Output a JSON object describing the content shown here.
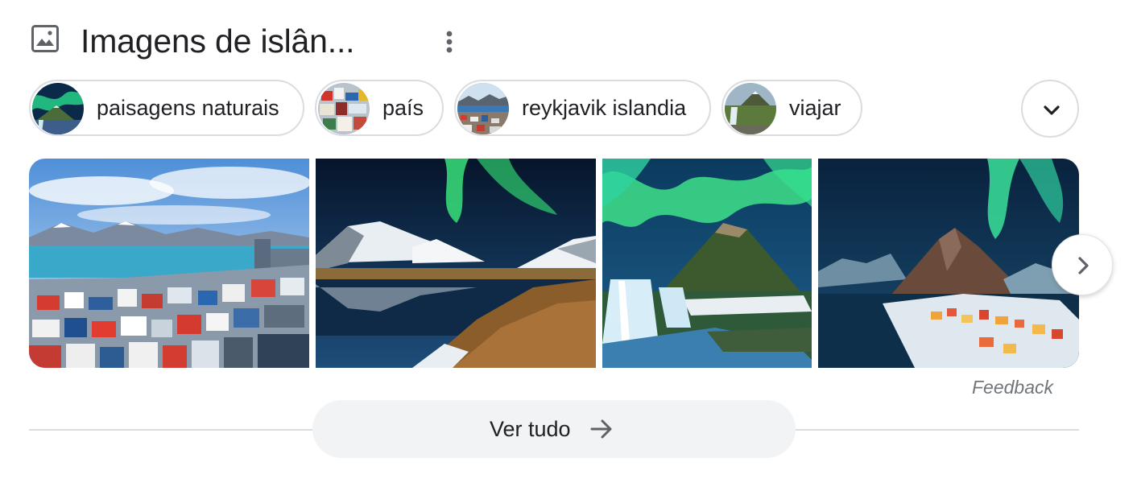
{
  "header": {
    "title": "Imagens de islân...",
    "icon": "image-icon",
    "more_icon": "more-vert-icon"
  },
  "chips": [
    {
      "label": "paisagens naturais",
      "thumb": "aurora-mountain"
    },
    {
      "label": "país",
      "thumb": "colorful-town"
    },
    {
      "label": "reykjavik islandia",
      "thumb": "city-coast"
    },
    {
      "label": "viajar",
      "thumb": "waterfall-mountain"
    }
  ],
  "expand_icon": "chevron-down-icon",
  "images": [
    {
      "subject": "reykjavik-city-view"
    },
    {
      "subject": "aurora-fjord-reflection"
    },
    {
      "subject": "kirkjufell-aurora-waterfall"
    },
    {
      "subject": "aurora-mountain-village"
    }
  ],
  "next_icon": "chevron-right-icon",
  "feedback_label": "Feedback",
  "see_all": {
    "label": "Ver tudo",
    "icon": "arrow-right-icon"
  },
  "colors": {
    "text": "#202124",
    "border": "#dadce0",
    "muted": "#70757a",
    "button_bg": "#f1f3f4"
  }
}
